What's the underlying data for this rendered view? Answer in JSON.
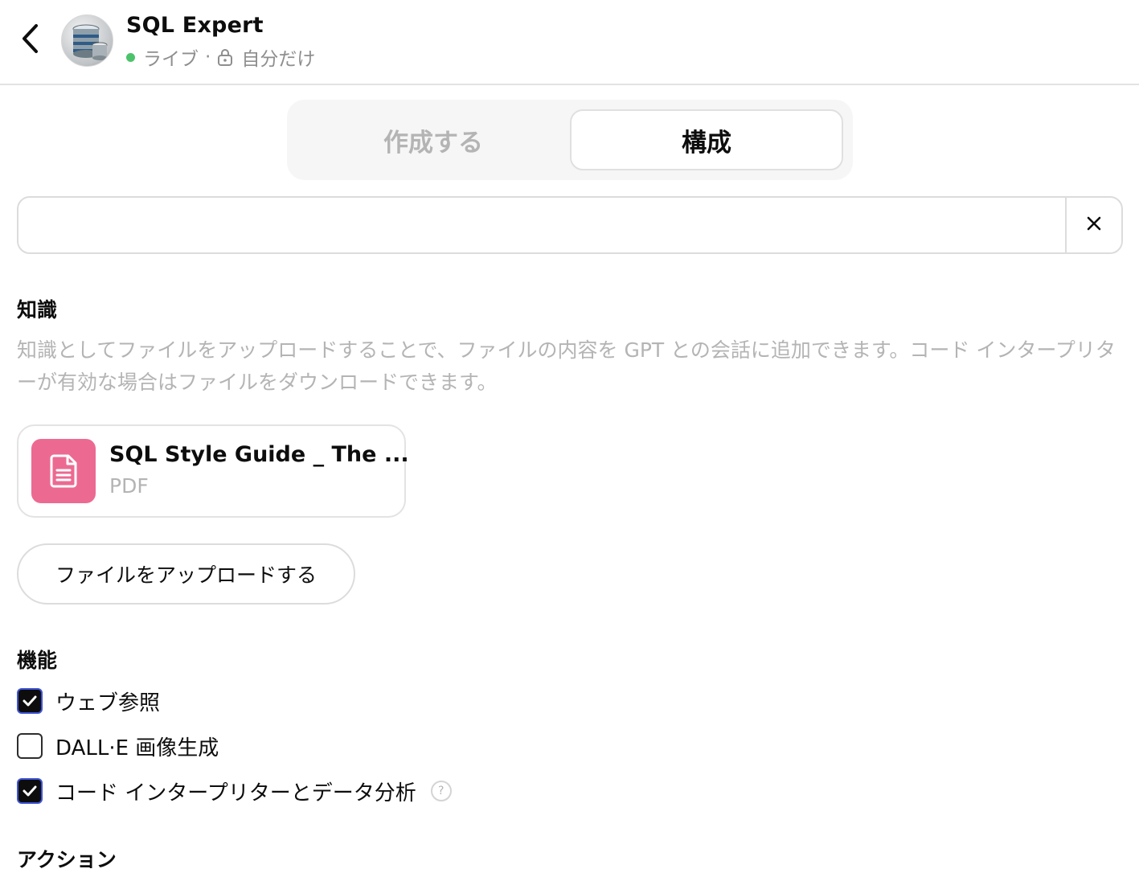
{
  "header": {
    "title": "SQL Expert",
    "status_live": "ライブ",
    "status_separator": "·",
    "status_visibility": "自分だけ",
    "icons": {
      "back": "chevron-left-icon",
      "lock": "lock-icon"
    },
    "colors": {
      "live_dot": "#4cc36a"
    }
  },
  "tabs": [
    {
      "label": "作成する",
      "selected": false
    },
    {
      "label": "構成",
      "selected": true
    }
  ],
  "field": {
    "value": "",
    "placeholder": ""
  },
  "knowledge": {
    "title": "知識",
    "description": "知識としてファイルをアップロードすることで、ファイルの内容を GPT との会話に追加できます。コード インタープリターが有効な場合はファイルをダウンロードできます。",
    "files": [
      {
        "name": "SQL Style Guide _ The ...",
        "type": "PDF",
        "icon_color": "#ec6a92"
      }
    ],
    "upload_label": "ファイルをアップロードする"
  },
  "capabilities": {
    "title": "機能",
    "items": [
      {
        "label": "ウェブ参照",
        "checked": true
      },
      {
        "label": "DALL·E 画像生成",
        "checked": false
      },
      {
        "label": "コード インタープリターとデータ分析",
        "checked": true,
        "help": "?"
      }
    ]
  },
  "actions": {
    "title": "アクション"
  }
}
